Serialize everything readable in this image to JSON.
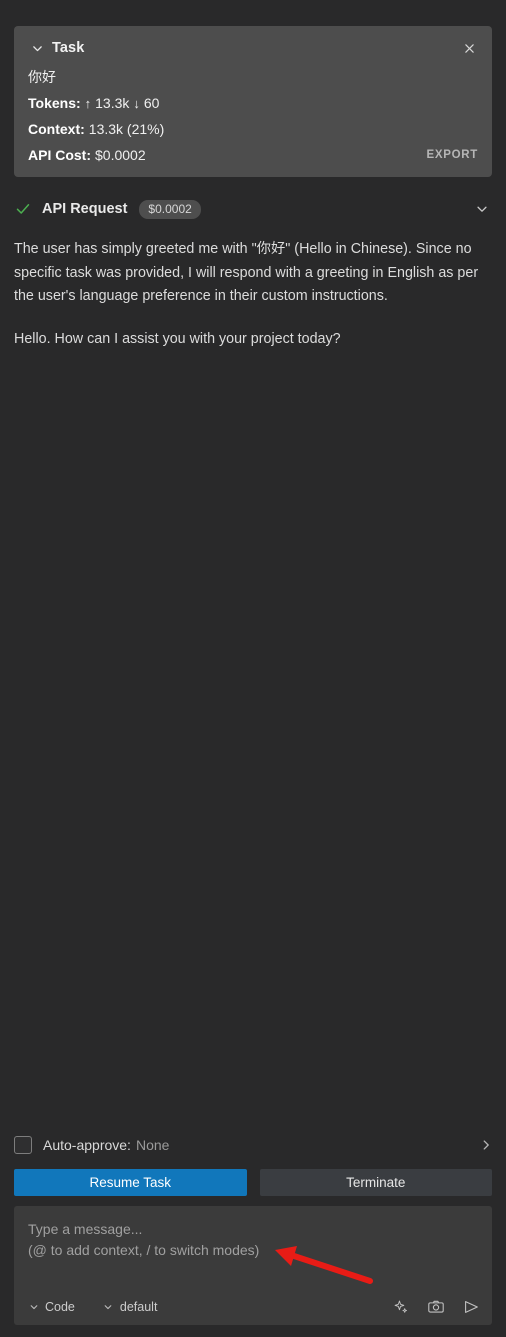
{
  "task": {
    "header_title": "Task",
    "collapse_icon": "chevron-down-icon",
    "close_icon": "close-icon",
    "prompt_text": "你好",
    "tokens_label": "Tokens:",
    "tokens_up_icon": "↑",
    "tokens_up_value": "13.3k",
    "tokens_down_icon": "↓",
    "tokens_down_value": "60",
    "context_label": "Context:",
    "context_value": "13.3k (21%)",
    "cost_label": "API Cost:",
    "cost_value": "$0.0002",
    "export_label": "EXPORT"
  },
  "api_request": {
    "status_icon": "check-icon",
    "label": "API Request",
    "cost_badge": "$0.0002",
    "expand_icon": "chevron-down-icon"
  },
  "message": {
    "paragraph_1": "The user has simply greeted me with \"你好\" (Hello in Chinese). Since no specific task was provided, I will respond with a greeting in English as per the user's language preference in their custom instructions.",
    "paragraph_2": "Hello. How can I assist you with your project today?"
  },
  "auto_approve": {
    "label": "Auto-approve:",
    "value": "None",
    "checked": false,
    "expand_icon": "chevron-right-icon"
  },
  "actions": {
    "primary_label": "Resume Task",
    "secondary_label": "Terminate"
  },
  "composer": {
    "placeholder_line_1": "Type a message...",
    "placeholder_line_2": "(@ to add context, / to switch modes)",
    "value": "",
    "mode_select": "Code",
    "profile_select": "default",
    "enhance_icon": "sparkle-icon",
    "screenshot_icon": "camera-icon",
    "send_icon": "send-icon"
  },
  "colors": {
    "background": "#29292a",
    "card": "#4d4d4d",
    "primary_button": "#1177bb",
    "secondary_button": "#3a3d41",
    "composer": "#3b3b3b",
    "check_green": "#4caf50",
    "annotation_red": "#e81c16"
  }
}
